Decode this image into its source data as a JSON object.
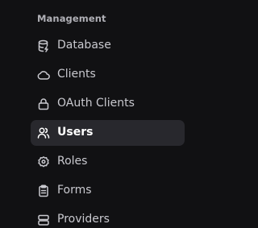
{
  "section": {
    "title": "Management"
  },
  "nav": {
    "items": [
      {
        "label": "Database",
        "icon": "database-icon",
        "active": false
      },
      {
        "label": "Clients",
        "icon": "cloud-icon",
        "active": false
      },
      {
        "label": "OAuth Clients",
        "icon": "lock-icon",
        "active": false
      },
      {
        "label": "Users",
        "icon": "users-icon",
        "active": true
      },
      {
        "label": "Roles",
        "icon": "badge-icon",
        "active": false
      },
      {
        "label": "Forms",
        "icon": "clipboard-icon",
        "active": false
      },
      {
        "label": "Providers",
        "icon": "server-icon",
        "active": false
      }
    ]
  },
  "colors": {
    "background": "#111113",
    "active_background": "#28282d",
    "text": "#c9c9cf",
    "active_text": "#ffffff",
    "section_title": "#b0b0b6"
  }
}
